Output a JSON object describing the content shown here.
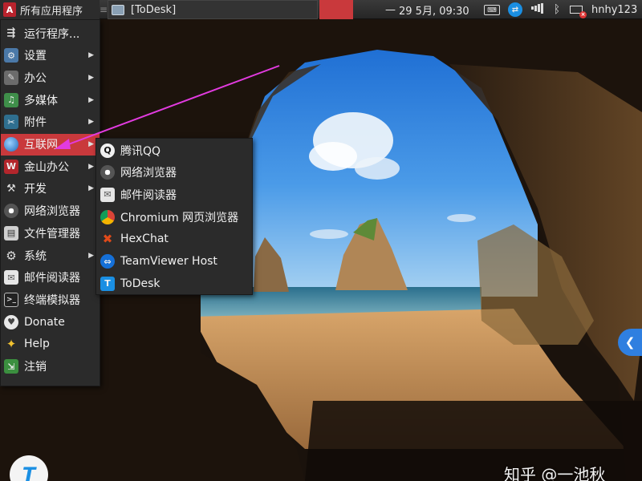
{
  "panel": {
    "apps_menu_label": "所有应用程序",
    "task_todesk_label": "[ToDesk]",
    "clock": "29 5月, 09:30",
    "clock_prefix": "—",
    "username": "hnhy123"
  },
  "main_menu": {
    "items": [
      {
        "label": "运行程序...",
        "icon": "run-icon",
        "submenu": false
      },
      {
        "label": "设置",
        "icon": "settings-icon",
        "submenu": true
      },
      {
        "label": "办公",
        "icon": "office-icon",
        "submenu": true
      },
      {
        "label": "多媒体",
        "icon": "multimedia-icon",
        "submenu": true
      },
      {
        "label": "附件",
        "icon": "accessories-icon",
        "submenu": true
      },
      {
        "label": "互联网",
        "icon": "internet-icon",
        "submenu": true,
        "active": true
      },
      {
        "label": "金山办公",
        "icon": "wps-icon",
        "submenu": true
      },
      {
        "label": "开发",
        "icon": "development-icon",
        "submenu": true
      },
      {
        "label": "网络浏览器",
        "icon": "web-browser-icon",
        "submenu": false
      },
      {
        "label": "文件管理器",
        "icon": "file-manager-icon",
        "submenu": false
      },
      {
        "label": "系统",
        "icon": "system-icon",
        "submenu": true
      },
      {
        "label": "邮件阅读器",
        "icon": "mail-reader-icon",
        "submenu": false
      },
      {
        "label": "终端模拟器",
        "icon": "terminal-icon",
        "submenu": false
      },
      {
        "label": "Donate",
        "icon": "donate-icon",
        "submenu": false
      },
      {
        "label": "Help",
        "icon": "help-icon",
        "submenu": false
      },
      {
        "label": "注销",
        "icon": "logout-icon",
        "submenu": false
      }
    ]
  },
  "internet_submenu": {
    "items": [
      {
        "label": "腾讯QQ",
        "icon": "qq-icon"
      },
      {
        "label": "网络浏览器",
        "icon": "web-browser-icon"
      },
      {
        "label": "邮件阅读器",
        "icon": "mail-reader-icon"
      },
      {
        "label": "Chromium 网页浏览器",
        "icon": "chromium-icon"
      },
      {
        "label": "HexChat",
        "icon": "hexchat-icon"
      },
      {
        "label": "TeamViewer Host",
        "icon": "teamviewer-icon"
      },
      {
        "label": "ToDesk",
        "icon": "todesk-icon"
      }
    ]
  },
  "watermark": "知乎 @一池秋",
  "colors": {
    "menu_bg": "#2b2b2b",
    "active_item": "#c9393c",
    "panel_bg": "#2e2e2e",
    "callout_arrow": "#e23be0",
    "todesk_blue": "#1a8fe3"
  }
}
